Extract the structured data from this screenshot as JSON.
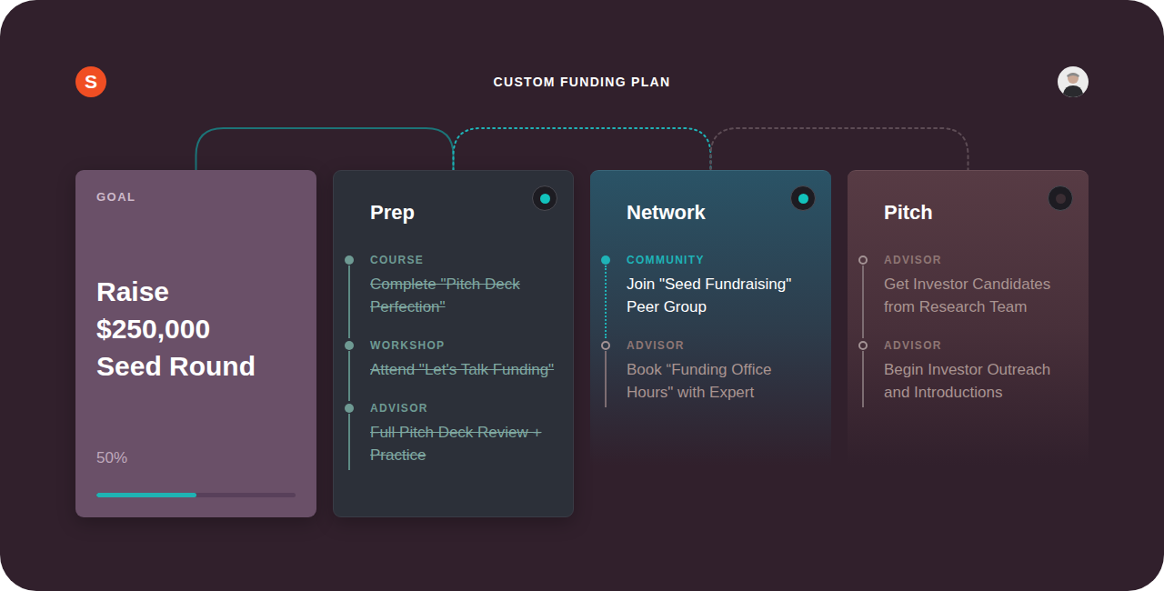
{
  "header": {
    "logo": "S",
    "title": "CUSTOM FUNDING PLAN"
  },
  "goal": {
    "label": "GOAL",
    "title_lines": [
      "Raise",
      "$250,000",
      "Seed Round"
    ],
    "progress_text": "50%",
    "level": 0.5
  },
  "stages": [
    {
      "title": "Prep",
      "status": "done",
      "items": [
        {
          "category": "COURSE",
          "title": "Complete \"Pitch Deck Perfection\"",
          "status": "done"
        },
        {
          "category": "WORKSHOP",
          "title": "Attend \"Let's Talk Funding\"",
          "status": "done"
        },
        {
          "category": "ADVISOR",
          "title": "Full Pitch Deck Review + Practice",
          "status": "done"
        }
      ]
    },
    {
      "title": "Network",
      "status": "active",
      "items": [
        {
          "category": "COMMUNITY",
          "title": "Join \"Seed Fundraising\" Peer Group",
          "status": "current"
        },
        {
          "category": "ADVISOR",
          "title": "Book “Funding Office Hours\" with Expert",
          "status": "upcoming"
        }
      ]
    },
    {
      "title": "Pitch",
      "status": "upcoming",
      "items": [
        {
          "category": "ADVISOR",
          "title": "Get Investor Candidates from Research Team",
          "status": "upcoming"
        },
        {
          "category": "ADVISOR",
          "title": "Begin Investor Outreach and Introductions",
          "status": "upcoming"
        }
      ]
    }
  ]
}
